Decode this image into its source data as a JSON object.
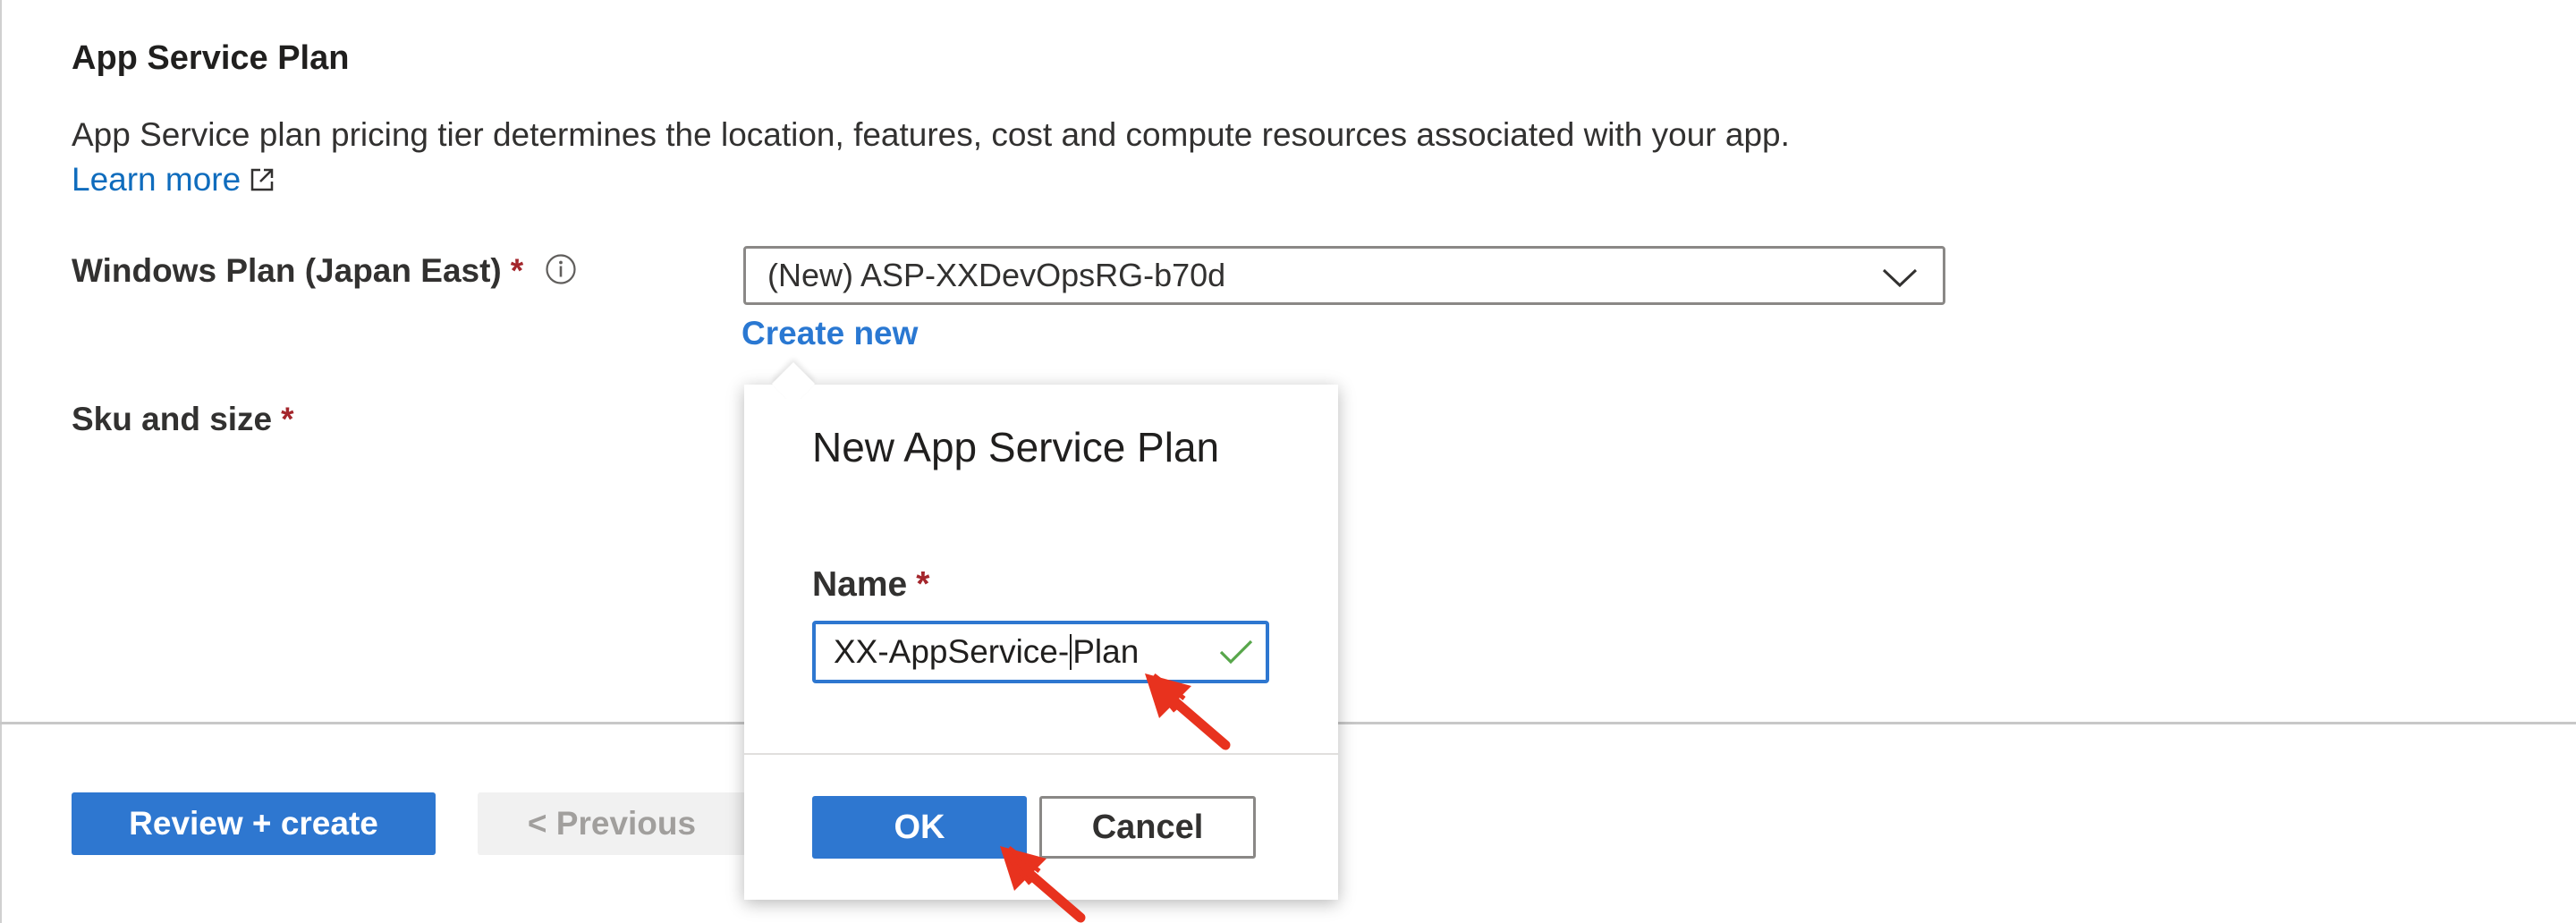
{
  "section": {
    "title": "App Service Plan",
    "description": "App Service plan pricing tier determines the location, features, cost and compute resources associated with your app.",
    "learn_more": "Learn more"
  },
  "fields": {
    "windows_plan_label": "Windows Plan (Japan East)",
    "windows_plan_value": "(New) ASP-XXDevOpsRG-b70d",
    "create_new": "Create new",
    "sku_label": "Sku and size",
    "required_mark": "*"
  },
  "footer": {
    "review_create": "Review + create",
    "previous": "< Previous"
  },
  "popup": {
    "title": "New App Service Plan",
    "name_label": "Name",
    "name_value_before_caret": "XX-AppService-",
    "name_value_after_caret": "Plan",
    "ok": "OK",
    "cancel": "Cancel"
  },
  "icons": {
    "info": "info-icon",
    "external_link": "external-link-icon",
    "dropdown": "chevron-down-icon",
    "valid": "checkmark-icon",
    "annotation": "red-arrow-annotation"
  },
  "colors": {
    "primary": "#2e77d0",
    "link": "#0f6cbd",
    "required": "#a4262c",
    "valid": "#57a64a",
    "annotation": "#e8321e"
  }
}
